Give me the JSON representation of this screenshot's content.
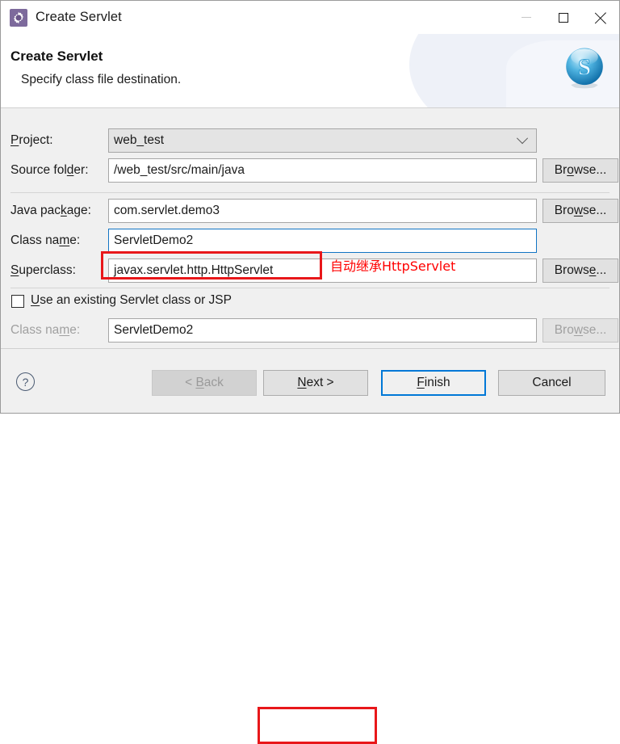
{
  "window": {
    "title": "Create Servlet",
    "app_icon": "gear-icon",
    "controls": {
      "minimize": "minimize-icon",
      "maximize": "maximize-icon",
      "close": "close-icon"
    }
  },
  "header": {
    "title": "Create Servlet",
    "subtitle": "Specify class file destination.",
    "logo": "sphere-s-logo"
  },
  "form": {
    "project": {
      "label_pre": "P",
      "label_mnemonic": "",
      "label": "Project:",
      "value": "web_test",
      "dropdown_icon": "chevron-down-icon"
    },
    "source_folder": {
      "label": "Source folder:",
      "value": "/web_test/src/main/java",
      "browse": "Browse..."
    },
    "java_package": {
      "label": "Java package:",
      "value": "com.servlet.demo3",
      "browse": "Browse..."
    },
    "class_name": {
      "label": "Class name:",
      "value": "ServletDemo2"
    },
    "superclass": {
      "label": "Superclass:",
      "value": "javax.servlet.http.HttpServlet",
      "browse": "Browse...",
      "annotation": "自动继承HttpServlet"
    },
    "use_existing": {
      "label": "Use an existing Servlet class or JSP",
      "checked": false
    },
    "existing_class_name": {
      "label": "Class name:",
      "value": "ServletDemo2",
      "browse": "Browse...",
      "disabled": true
    }
  },
  "footer": {
    "help": "?",
    "back": "< Back",
    "next": "Next >",
    "finish": "Finish",
    "cancel": "Cancel"
  },
  "colors": {
    "accent": "#0078d7",
    "annotation": "#ff0000",
    "highlight_box": "#e8171a",
    "dialog_bg": "#f0f0f0"
  }
}
